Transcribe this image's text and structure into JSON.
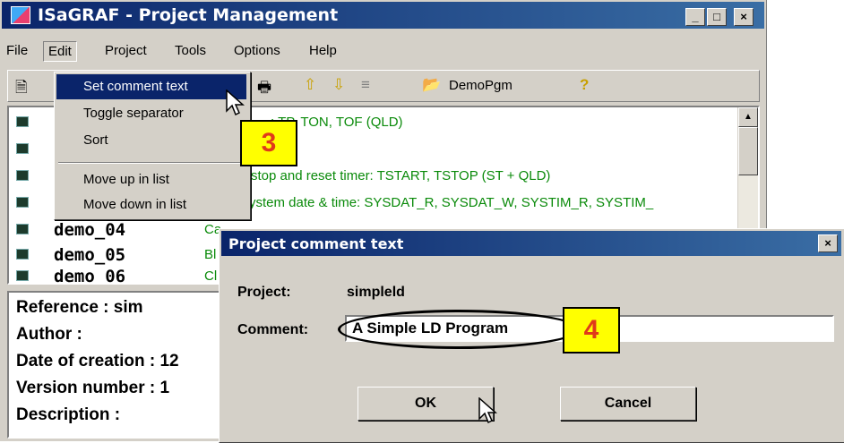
{
  "window": {
    "title": "ISaGRAF - Project Management",
    "minimize": "_",
    "maximize": "□",
    "close": "×"
  },
  "menubar": {
    "items": [
      "File",
      "Edit",
      "Project",
      "Tools",
      "Options",
      "Help"
    ]
  },
  "toolbar": {
    "demopgm_label": "DemoPgm"
  },
  "edit_menu": {
    "items": [
      "Set comment text",
      "Toggle separator",
      "Sort",
      "Move up in list",
      "Move down in list"
    ]
  },
  "project_list": {
    "visible_comments": [
      ": TP, TON, TOF  (QLD)",
      "stop and reset timer:  TSTART, TSTOP  (ST + QLD)",
      "ystem date & time:  SYSDAT_R, SYSDAT_W, SYSTIM_R, SYSTIM_"
    ],
    "rows": [
      {
        "name": "demo_04",
        "comment": "Ca"
      },
      {
        "name": "demo_05",
        "comment": "Bl"
      },
      {
        "name": "demo_06",
        "comment": "Cl"
      }
    ]
  },
  "info_panel": {
    "lines": [
      "Reference       : sim",
      "Author          :",
      "Date of creation : 12",
      "Version number  : 1",
      "Description     :"
    ]
  },
  "dialog": {
    "title": "Project comment text",
    "close": "×",
    "project_label": "Project:",
    "project_value": "simpleld",
    "comment_label": "Comment:",
    "comment_value": "A Simple LD Program",
    "ok_label": "OK",
    "cancel_label": "Cancel"
  },
  "callouts": {
    "step3": "3",
    "step4": "4"
  },
  "colors": {
    "titlebar": "#0a246a",
    "comment_text": "#0a8a0a",
    "callout_bg": "#ffff00",
    "callout_text": "#e03a1a"
  }
}
